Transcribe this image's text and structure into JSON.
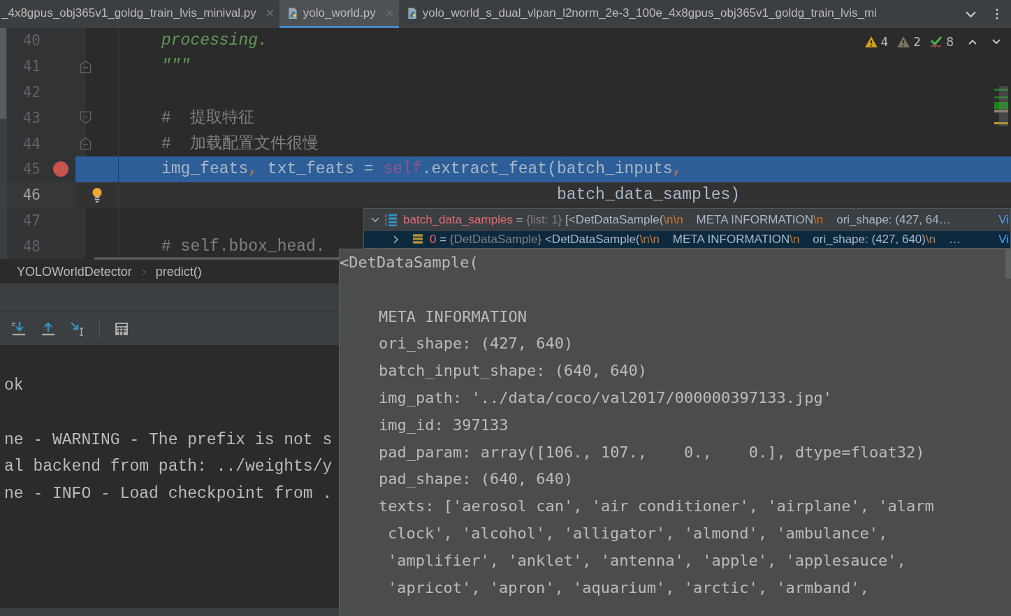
{
  "tabs": [
    {
      "label": "_4x8gpus_obj365v1_goldg_train_lvis_minival.py",
      "selected": false
    },
    {
      "label": "yolo_world.py",
      "selected": true
    },
    {
      "label": "yolo_world_s_dual_vlpan_l2norm_2e-3_100e_4x8gpus_obj365v1_goldg_train_lvis_mi",
      "selected": false
    }
  ],
  "inspections": [
    {
      "kind": "warning",
      "count": "4"
    },
    {
      "kind": "weak",
      "count": "2"
    },
    {
      "kind": "typo",
      "count": "8"
    }
  ],
  "editor": {
    "lines": [
      {
        "number": "40",
        "breakpoint": false,
        "execution": false,
        "current": false,
        "bulb": false,
        "segments": [
          {
            "kind": "doc",
            "text": "processing."
          }
        ]
      },
      {
        "number": "41",
        "breakpoint": false,
        "execution": false,
        "current": false,
        "bulb": false,
        "segments": [
          {
            "kind": "doc",
            "text": "\"\"\""
          }
        ]
      },
      {
        "number": "42",
        "breakpoint": false,
        "execution": false,
        "current": false,
        "bulb": false
      },
      {
        "number": "43",
        "breakpoint": false,
        "execution": false,
        "current": false,
        "bulb": false,
        "segments": [
          {
            "kind": "comment",
            "text": "#  提取特征"
          }
        ]
      },
      {
        "number": "44",
        "breakpoint": false,
        "execution": false,
        "current": false,
        "bulb": false,
        "segments": [
          {
            "kind": "comment",
            "text": "#  加载配置文件很慢"
          }
        ]
      },
      {
        "number": "45",
        "breakpoint": true,
        "execution": true,
        "current": false,
        "bulb": false,
        "segments": [
          {
            "kind": "plain",
            "text": "img_feats"
          },
          {
            "kind": "punct",
            "text": ","
          },
          {
            "kind": "plain",
            "text": " txt_feats = "
          },
          {
            "kind": "self",
            "text": "self"
          },
          {
            "kind": "plain",
            "text": ".extract_feat(batch_inputs"
          },
          {
            "kind": "punct",
            "text": ","
          }
        ]
      },
      {
        "number": "46",
        "breakpoint": false,
        "execution": false,
        "current": true,
        "bulb": true,
        "segments": [
          {
            "kind": "plain",
            "text": "                                         batch_data_samples)"
          }
        ]
      },
      {
        "number": "47",
        "breakpoint": false,
        "execution": false,
        "current": false,
        "bulb": false
      },
      {
        "number": "48",
        "breakpoint": false,
        "execution": false,
        "current": false,
        "bulb": false,
        "segments": [
          {
            "kind": "comment",
            "text": "# self.bbox_head."
          }
        ]
      }
    ]
  },
  "breadcrumb": [
    "YOLOWorldDetector",
    "predict()"
  ],
  "console": {
    "groups": [
      [
        "ok"
      ],
      [
        "ne - WARNING - The prefix is not s",
        "al backend from path: ../weights/y",
        "ne - INFO - Load checkpoint from ."
      ]
    ]
  },
  "variables": [
    {
      "expanded": true,
      "selected": false,
      "segments": [
        {
          "kind": "name",
          "text": "batch_data_samples"
        },
        {
          "kind": "plain",
          "text": " = "
        },
        {
          "kind": "type",
          "text": "{list: 1}"
        },
        {
          "kind": "plain",
          "text": " [<DetDataSample("
        },
        {
          "kind": "esc",
          "text": "\\n\\n"
        },
        {
          "kind": "plain",
          "text": "    META INFORMATION"
        },
        {
          "kind": "esc",
          "text": "\\n"
        },
        {
          "kind": "plain",
          "text": "    ori_shape: (427, 64…"
        }
      ],
      "link": "Vi"
    },
    {
      "expanded": false,
      "selected": true,
      "segments": [
        {
          "kind": "name",
          "text": "0"
        },
        {
          "kind": "plain",
          "text": " = "
        },
        {
          "kind": "type",
          "text": "{DetDataSample}"
        },
        {
          "kind": "plain",
          "text": " <DetDataSample("
        },
        {
          "kind": "esc",
          "text": "\\n\\n"
        },
        {
          "kind": "plain",
          "text": "    META INFORMATION"
        },
        {
          "kind": "esc",
          "text": "\\n"
        },
        {
          "kind": "plain",
          "text": "    ori_shape: (427, 640)"
        },
        {
          "kind": "esc",
          "text": "\\n"
        },
        {
          "kind": "plain",
          "text": "    …"
        }
      ],
      "link": "Vi"
    }
  ],
  "tooltip": {
    "lines": [
      {
        "kind": "head",
        "text": "<DetDataSample("
      },
      {
        "kind": "gap-field",
        "text": "META INFORMATION"
      },
      {
        "kind": "field",
        "text": "ori_shape: (427, 640)"
      },
      {
        "kind": "field",
        "text": "batch_input_shape: (640, 640)"
      },
      {
        "kind": "field",
        "text": "img_path: '../data/coco/val2017/000000397133.jpg'"
      },
      {
        "kind": "field",
        "text": "img_id: 397133"
      },
      {
        "kind": "field",
        "text": "pad_param: array([106., 107.,    0.,    0.], dtype=float32)"
      },
      {
        "kind": "field",
        "text": "pad_shape: (640, 640)"
      },
      {
        "kind": "field",
        "text": "texts: ['aerosol can', 'air conditioner', 'airplane', 'alarm"
      },
      {
        "kind": "cont",
        "text": "clock', 'alcohol', 'alligator', 'almond', 'ambulance',"
      },
      {
        "kind": "cont",
        "text": "'amplifier', 'anklet', 'antenna', 'apple', 'applesauce',"
      },
      {
        "kind": "cont",
        "text": "'apricot', 'apron', 'aquarium', 'arctic', 'armband',"
      }
    ]
  }
}
